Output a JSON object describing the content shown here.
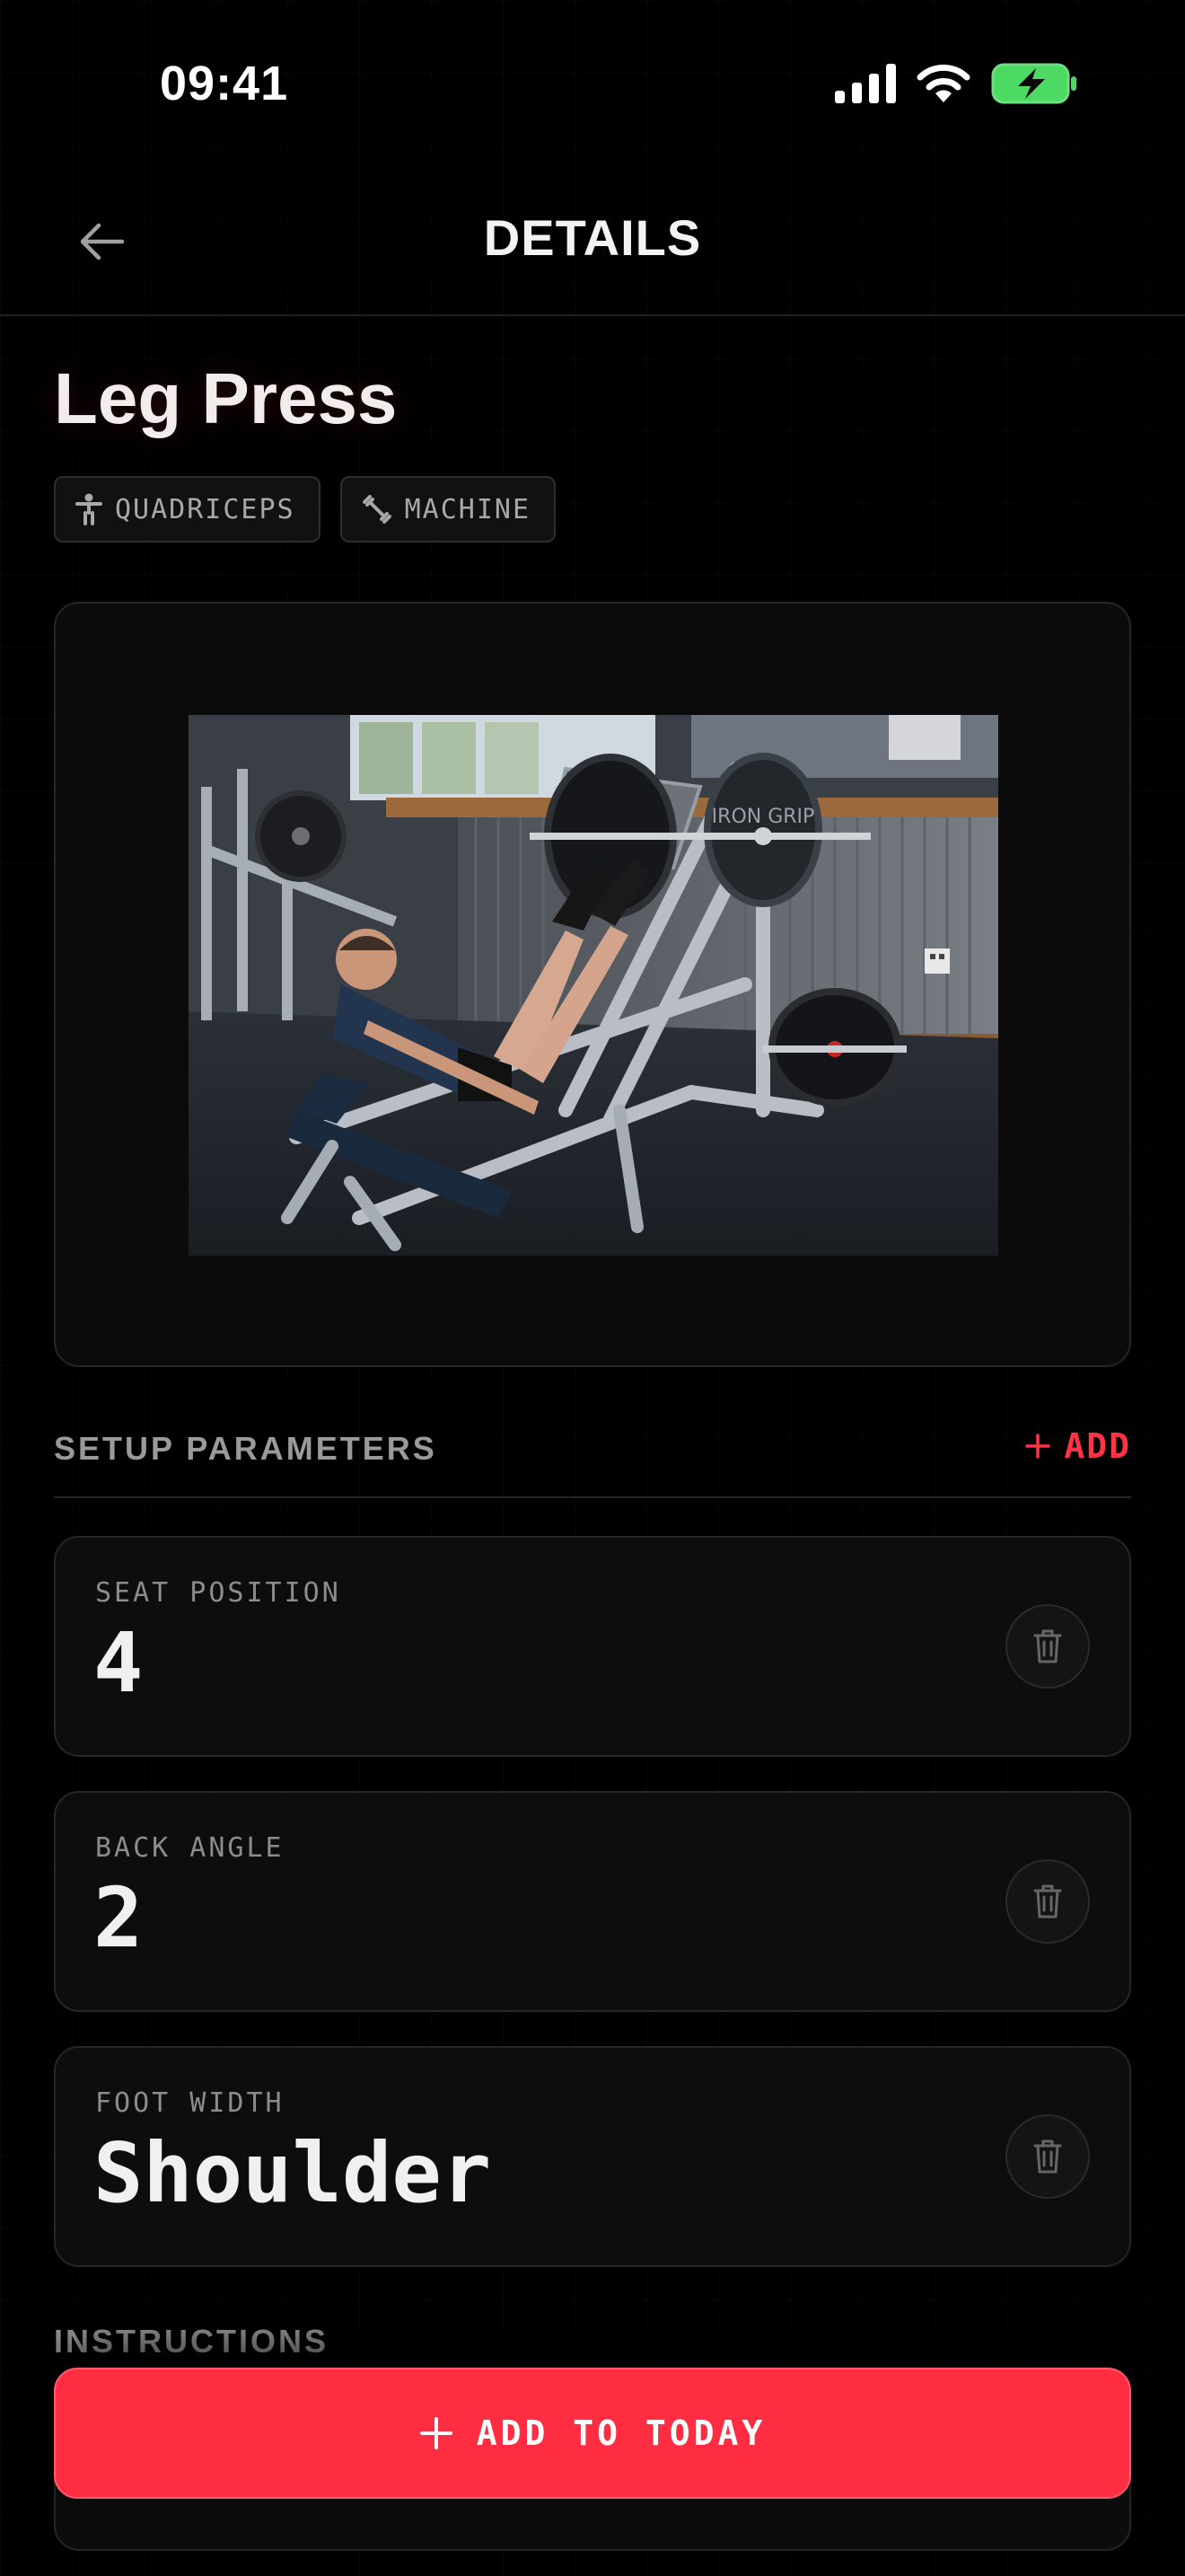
{
  "status_bar": {
    "time": "09:41"
  },
  "header": {
    "title": "DETAILS"
  },
  "exercise": {
    "name": "Leg Press",
    "tags": [
      {
        "label": "QUADRICEPS",
        "icon": "person-icon"
      },
      {
        "label": "MACHINE",
        "icon": "dumbbell-icon"
      }
    ]
  },
  "setup": {
    "title": "SETUP PARAMETERS",
    "add_label": "ADD",
    "params": [
      {
        "label": "SEAT POSITION",
        "value": "4"
      },
      {
        "label": "BACK ANGLE",
        "value": "2"
      },
      {
        "label": "FOOT WIDTH",
        "value": "Shoulder"
      }
    ]
  },
  "instructions": {
    "title": "INSTRUCTIONS"
  },
  "cta": {
    "label": "ADD TO TODAY"
  },
  "colors": {
    "accent": "#ff2d42",
    "background": "#000000",
    "battery": "#4cd964"
  }
}
